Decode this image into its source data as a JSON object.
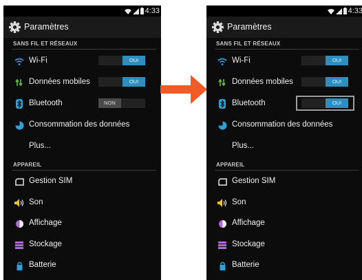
{
  "status_bar": {
    "time": "4:33"
  },
  "action_bar": {
    "title": "Paramètres"
  },
  "sections": {
    "wireless_header": "SANS FIL ET RÉSEAUX",
    "device_header": "APPAREIL"
  },
  "items": {
    "wifi": "Wi-Fi",
    "mobile_data": "Données mobiles",
    "bluetooth": "Bluetooth",
    "data_usage": "Consommation des données",
    "more": "Plus...",
    "sim": "Gestion SIM",
    "sound": "Son",
    "display": "Affichage",
    "storage": "Stockage",
    "battery": "Batterie"
  },
  "toggles": {
    "on_label": "OUI",
    "off_label": "NON",
    "before": {
      "wifi": "on",
      "mobile_data": "on",
      "bluetooth": "off"
    },
    "after": {
      "wifi": "on",
      "mobile_data": "on",
      "bluetooth": "on"
    }
  },
  "colors": {
    "toggle_on": "#2e8fbf",
    "toggle_off": "#4a4a4a",
    "arrow": "#f05a28",
    "icon_blue": "#2fa0d6",
    "icon_green": "#5fbf3f",
    "icon_purple": "#b06ad6",
    "icon_yellow": "#e6c23a"
  }
}
